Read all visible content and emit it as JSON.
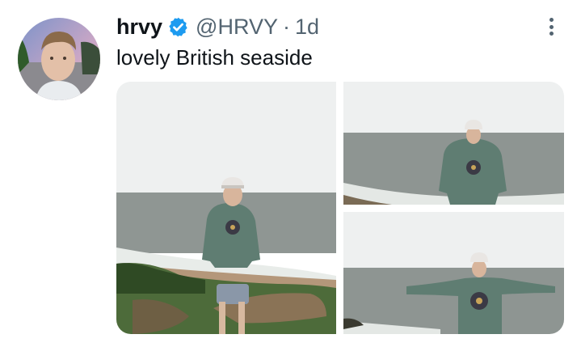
{
  "tweet": {
    "author_name": "hrvy",
    "handle": "@HRVY",
    "separator": "·",
    "time": "1d",
    "text": "lovely British seaside",
    "verified": true
  },
  "icons": {
    "verified": "verified-badge-icon",
    "more": "vertical-dots-icon"
  },
  "colors": {
    "verified_blue": "#1d9bf0",
    "secondary_text": "#536471",
    "primary_text": "#0f1419"
  }
}
